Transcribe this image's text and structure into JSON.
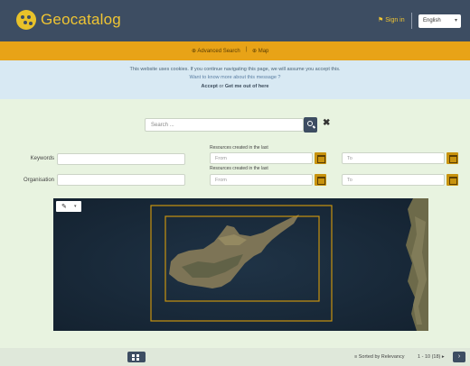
{
  "header": {
    "app_title": "Geocatalog",
    "signin_label": "⚑ Sign in",
    "language": "English"
  },
  "nav": {
    "advanced_search": "⊕ Advanced Search",
    "map": "⊕ Map"
  },
  "cookie": {
    "line1": "This website uses cookies. If you continue navigating this page, we will assume you accept this.",
    "line2": "Want to know more about this message ?",
    "accept": "Accept",
    "or": "or",
    "get_out": "Get me out of here"
  },
  "search": {
    "placeholder": "Search ..."
  },
  "filters": {
    "keywords_label": "Keywords",
    "organisation_label": "Organisation",
    "resource_created_caption_1": "Resources created in the last",
    "resource_created_caption_2": "Resources created in the last",
    "from_placeholder": "From",
    "to_placeholder": "To"
  },
  "results": {
    "sort_label": "≡ Sorted by Relevancy",
    "page_range": "1 - 10 (18) ▸"
  },
  "colors": {
    "header_bg": "#3d4d62",
    "accent_yellow": "#f0c533",
    "nav_orange": "#e8a317",
    "page_green": "#e8f3e0"
  }
}
